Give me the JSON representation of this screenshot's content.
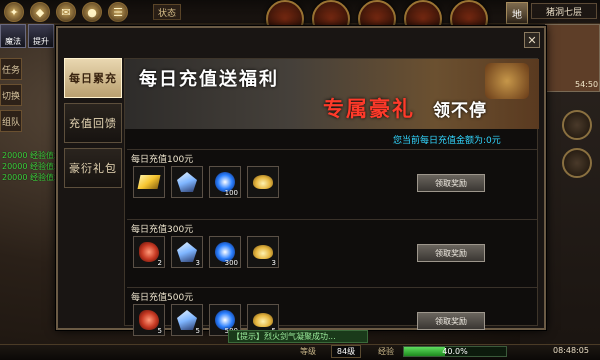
{
  "top": {
    "status_label": "状态",
    "map_button": "地",
    "map_name": "猪洞七层",
    "minimap_time": "54:50"
  },
  "left": {
    "avatar_labels": [
      "魔法",
      "提升"
    ],
    "tabs": [
      "任务",
      "切换",
      "组队"
    ],
    "log_lines": [
      "20000 经验值增加",
      "20000 经验值增加",
      "20000 经验值增加"
    ]
  },
  "dialog": {
    "nav": [
      {
        "label": "每日累充",
        "active": true
      },
      {
        "label": "充值回馈",
        "active": false
      },
      {
        "label": "豪衍礼包",
        "active": false
      }
    ],
    "banner": {
      "title": "每日充值送福利",
      "sub_red": "专属豪礼",
      "sub_white": "领不停"
    },
    "total_text": "您当前每日充值金额为:0元",
    "tiers": [
      {
        "title": "每日充值100元",
        "button": "领取奖励",
        "items": [
          {
            "icon": "gold-bar-icon",
            "qty": "",
            "color": "#f5c430"
          },
          {
            "icon": "crystal-icon",
            "qty": "",
            "color": "#7fb6ff"
          },
          {
            "icon": "blue-orb-icon",
            "qty": "100",
            "color": "#2a7fff"
          },
          {
            "icon": "gold-ingot-icon",
            "qty": "",
            "color": "#e6b640"
          }
        ]
      },
      {
        "title": "每日充值300元",
        "button": "领取奖励",
        "items": [
          {
            "icon": "red-stone-icon",
            "qty": "2",
            "color": "#c83a24"
          },
          {
            "icon": "crystal-icon",
            "qty": "3",
            "color": "#7fb6ff"
          },
          {
            "icon": "blue-orb-icon",
            "qty": "300",
            "color": "#2a7fff"
          },
          {
            "icon": "gold-ingot-icon",
            "qty": "3",
            "color": "#e6b640"
          }
        ]
      },
      {
        "title": "每日充值500元",
        "button": "领取奖励",
        "items": [
          {
            "icon": "red-stone-icon",
            "qty": "5",
            "color": "#c83a24"
          },
          {
            "icon": "crystal-icon",
            "qty": "5",
            "color": "#7fb6ff"
          },
          {
            "icon": "blue-orb-icon",
            "qty": "500",
            "color": "#2a7fff"
          },
          {
            "icon": "gold-ingot-icon",
            "qty": "5",
            "color": "#e6b640"
          }
        ]
      }
    ]
  },
  "bottom": {
    "notice": "【提示】烈火剑气凝聚成功...",
    "level_label": "等级",
    "level_value": "84级",
    "xp_label": "经验",
    "xp_percent": "40.0%",
    "xp_fraction": 0.4,
    "clock": "08:48:05"
  }
}
